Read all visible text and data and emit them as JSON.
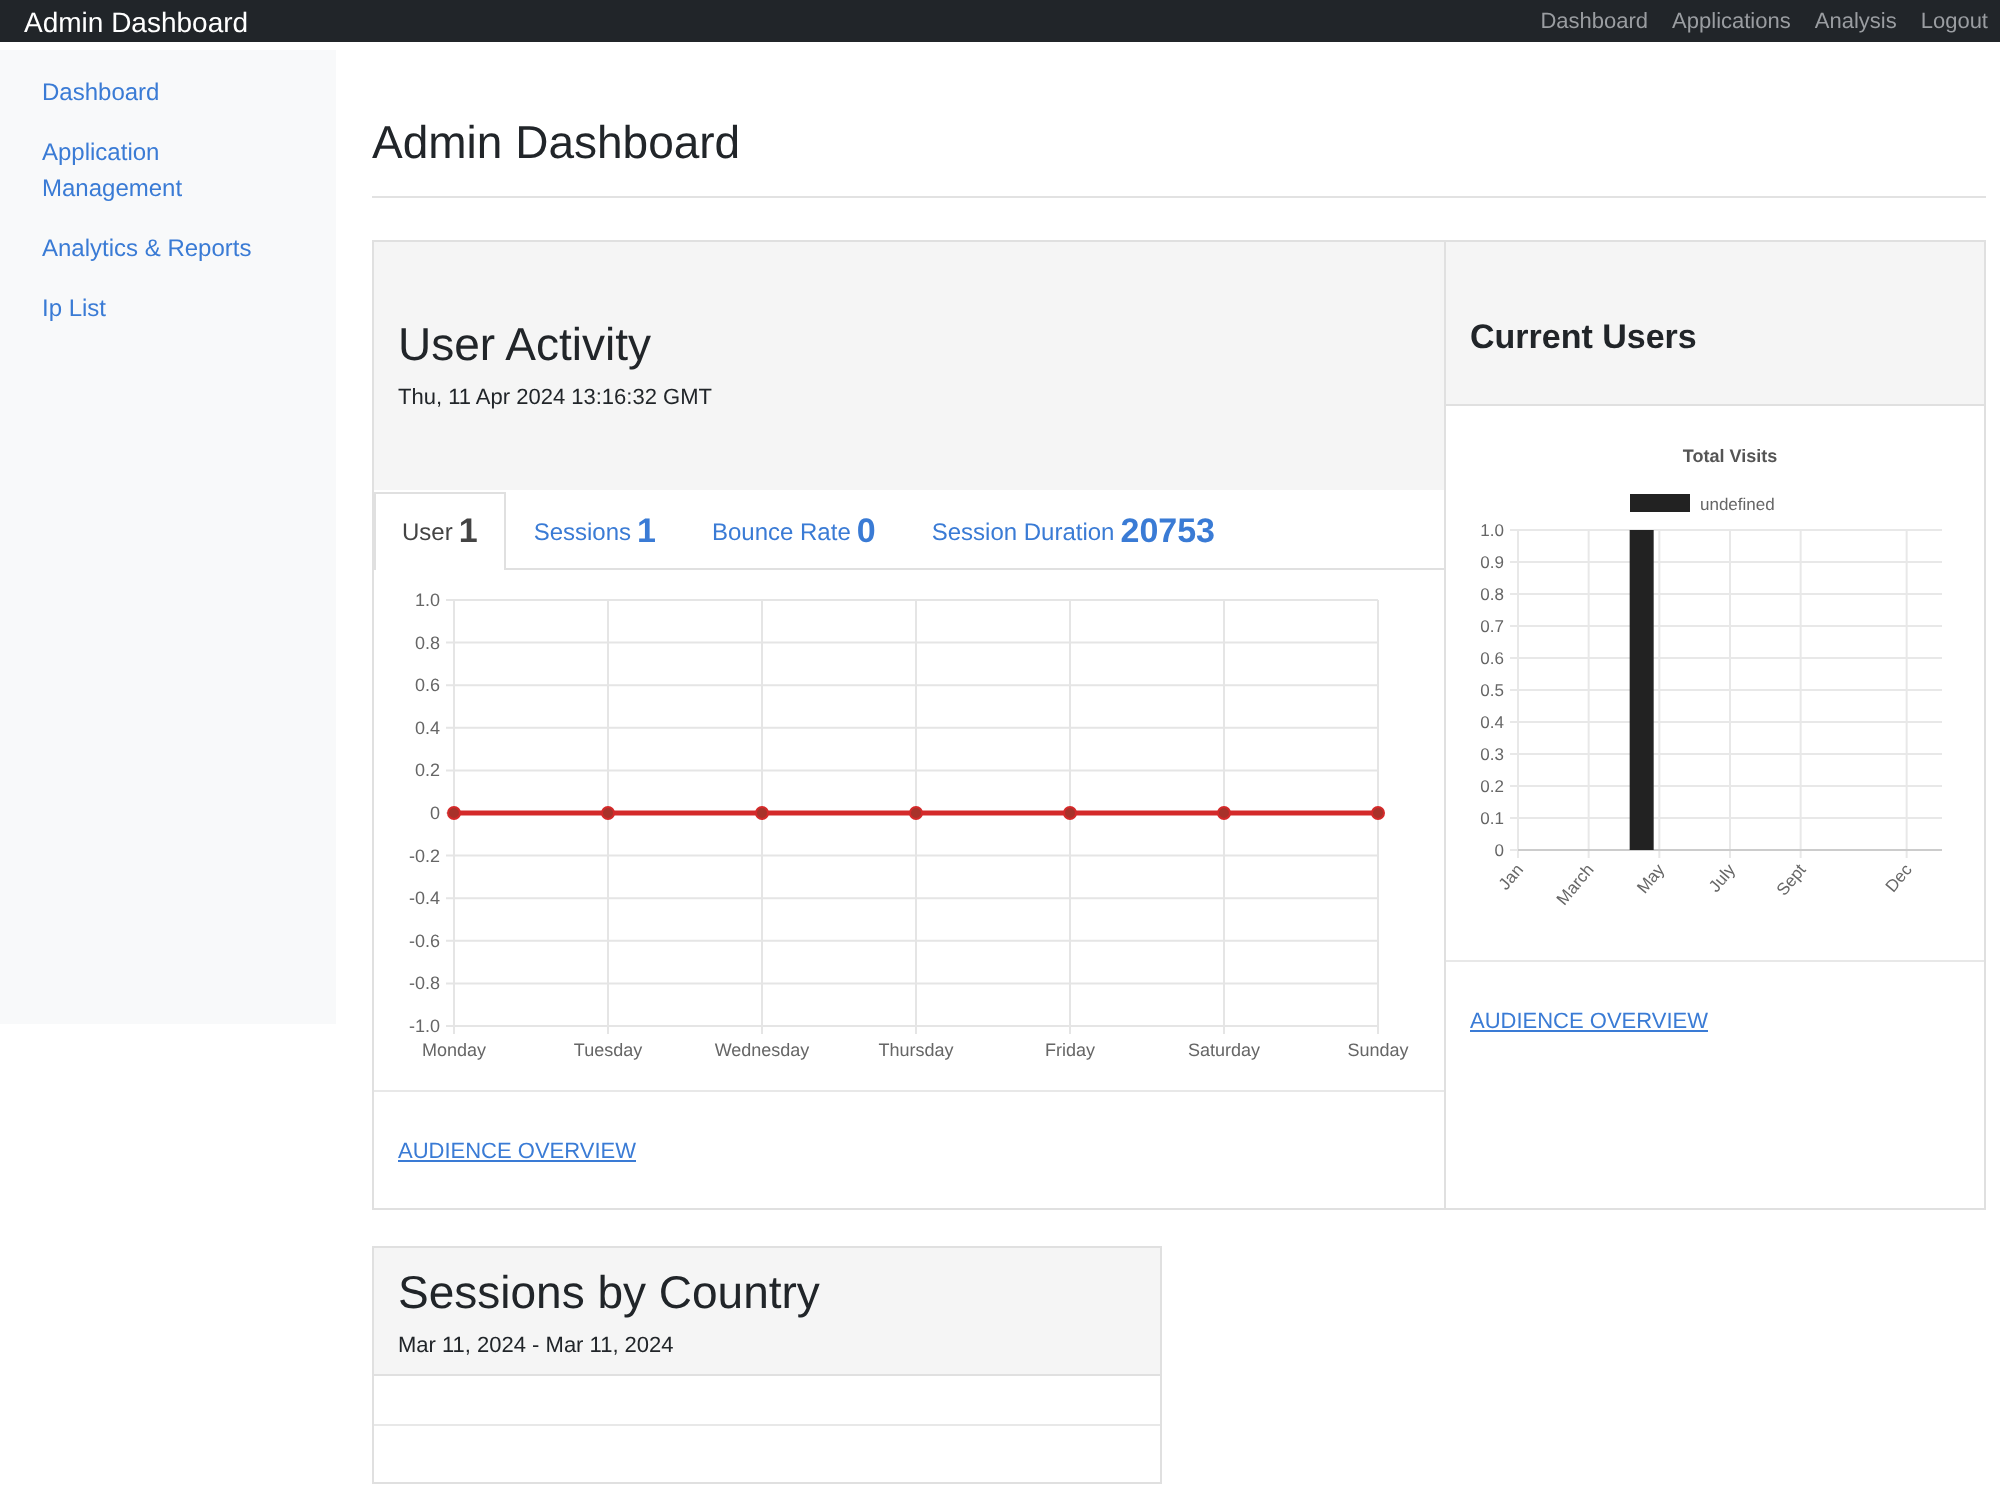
{
  "navbar": {
    "brand": "Admin Dashboard",
    "links": [
      "Dashboard",
      "Applications",
      "Analysis",
      "Logout"
    ]
  },
  "sidebar": {
    "items": [
      {
        "label": "Dashboard"
      },
      {
        "label": "Application Management"
      },
      {
        "label": "Analytics & Reports"
      },
      {
        "label": "Ip List"
      }
    ]
  },
  "page_title": "Admin Dashboard",
  "user_activity": {
    "title": "User Activity",
    "timestamp": "Thu, 11 Apr 2024 13:16:32 GMT",
    "tabs": [
      {
        "label": "User",
        "value": "1",
        "selected": true
      },
      {
        "label": "Sessions",
        "value": "1",
        "selected": false
      },
      {
        "label": "Bounce Rate",
        "value": "0",
        "selected": false
      },
      {
        "label": "Session Duration",
        "value": "20753",
        "selected": false
      }
    ],
    "chart_data": {
      "type": "line",
      "categories": [
        "Monday",
        "Tuesday",
        "Wednesday",
        "Thursday",
        "Friday",
        "Saturday",
        "Sunday"
      ],
      "series": [
        {
          "color": "#d42a2a",
          "marker": true,
          "values": [
            0,
            0,
            0,
            0,
            0,
            0,
            0
          ]
        }
      ],
      "grid": true,
      "ylim": [
        -1,
        1
      ],
      "yticks": [
        {
          "value": 1,
          "label": "1.0"
        },
        0.8,
        0.6,
        0.4,
        0.2,
        0,
        -0.2,
        -0.4,
        -0.6,
        -0.8,
        {
          "value": -1,
          "label": "-1.0"
        }
      ]
    },
    "footer_link": "AUDIENCE OVERVIEW"
  },
  "current_users": {
    "title": "Current Users",
    "chart_data": {
      "type": "bar",
      "title": "Total Visits",
      "categories": [
        "Jan",
        null,
        "March",
        null,
        "May",
        null,
        "July",
        null,
        "Sept",
        null,
        null,
        "Dec"
      ],
      "series": [
        {
          "name": "undefined",
          "color": "#222222",
          "values": [
            null,
            null,
            null,
            1,
            null,
            null,
            null,
            null,
            null,
            null,
            null,
            null
          ]
        }
      ],
      "grid": true,
      "ylim": [
        0,
        1
      ],
      "yticks": [
        {
          "value": 1,
          "label": "1.0"
        },
        0.9,
        0.8,
        0.7,
        0.6,
        0.5,
        0.4,
        0.3,
        0.2,
        0.1,
        0
      ]
    },
    "footer_link": "AUDIENCE OVERVIEW"
  },
  "sessions_by_country": {
    "title": "Sessions by Country",
    "date_range": "Mar 11, 2024 - Mar 11, 2024"
  }
}
